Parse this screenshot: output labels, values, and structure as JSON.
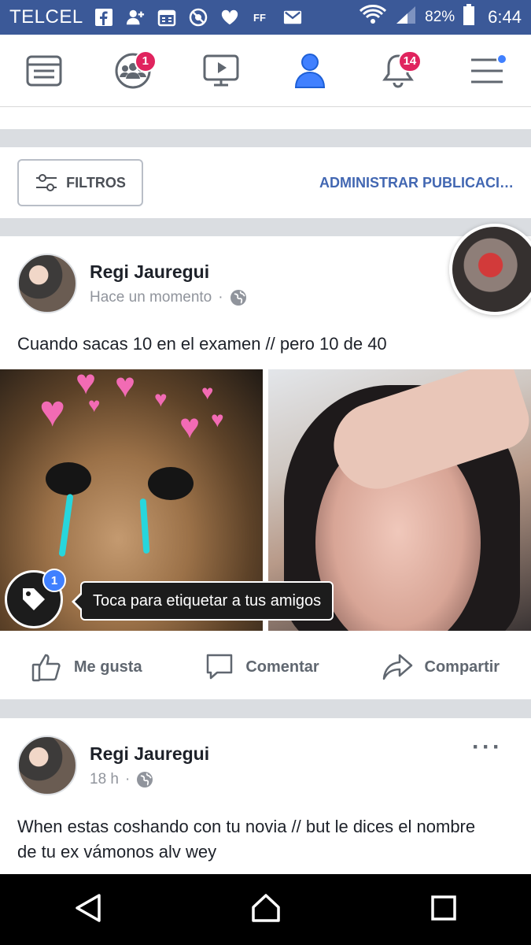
{
  "status_bar": {
    "carrier": "TELCEL",
    "battery_percent": "82%",
    "time": "6:44"
  },
  "nav": {
    "items": [
      {
        "name": "news-feed",
        "badge": ""
      },
      {
        "name": "groups",
        "badge": "1"
      },
      {
        "name": "watch",
        "badge": ""
      },
      {
        "name": "profile",
        "badge": ""
      },
      {
        "name": "notifications",
        "badge": "14"
      },
      {
        "name": "menu",
        "badge": ""
      }
    ]
  },
  "filter_row": {
    "filter_label": "FILTROS",
    "manage_label": "ADMINISTRAR PUBLICACI…"
  },
  "post1": {
    "author": "Regi Jauregui",
    "time": "Hace un momento",
    "text": "Cuando sacas 10 en el examen // pero 10 de 40",
    "tag_badge": "1",
    "tooltip": "Toca para etiquetar a tus amigos"
  },
  "actions": {
    "like": "Me gusta",
    "comment": "Comentar",
    "share": "Compartir"
  },
  "post2": {
    "author": "Regi Jauregui",
    "time": "18 h",
    "text": "When estas coshando con tu novia // but le dices el nombre de tu ex vámonos alv wey"
  },
  "colors": {
    "brand": "#3b5998",
    "link": "#4267b2",
    "badge": "#e0245e",
    "new_dot": "#4080ff"
  }
}
